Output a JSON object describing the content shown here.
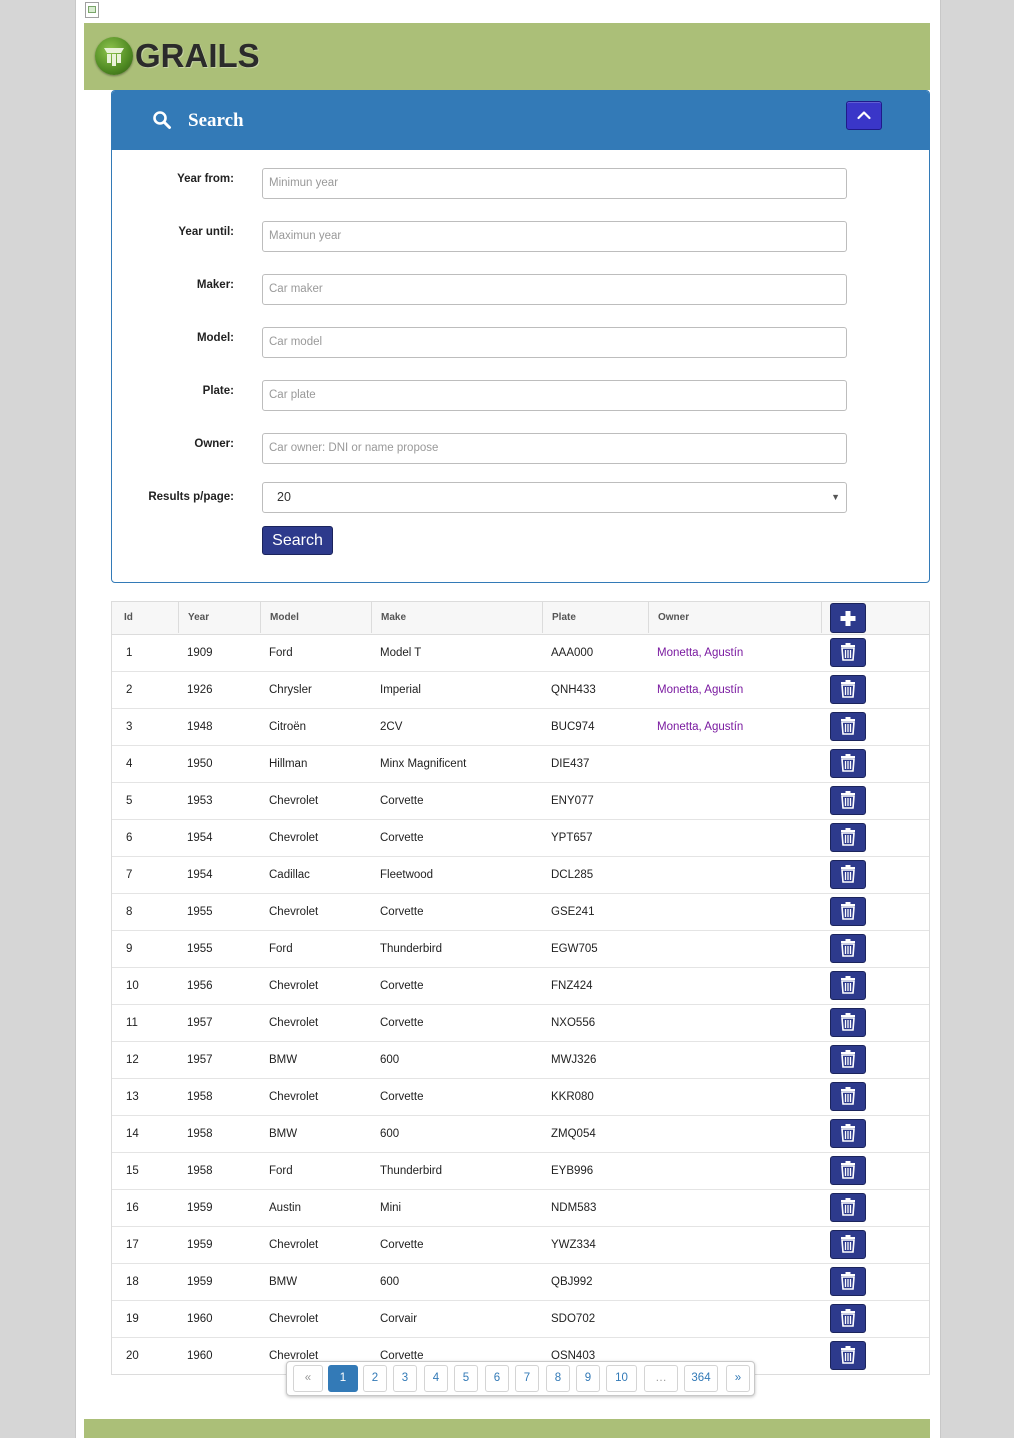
{
  "brand": {
    "name": "GRAILS"
  },
  "search_panel": {
    "title": "Search",
    "fields": [
      {
        "label": "Year from:",
        "placeholder": "Minimun year"
      },
      {
        "label": "Year until:",
        "placeholder": "Maximun year"
      },
      {
        "label": "Maker:",
        "placeholder": "Car maker"
      },
      {
        "label": "Model:",
        "placeholder": "Car model"
      },
      {
        "label": "Plate:",
        "placeholder": "Car plate"
      },
      {
        "label": "Owner:",
        "placeholder": "Car owner: DNI or name propose"
      }
    ],
    "results_per_page": {
      "label": "Results p/page:",
      "value": "20"
    },
    "search_button": "Search"
  },
  "table": {
    "columns": [
      "Id",
      "Year",
      "Model",
      "Make",
      "Plate",
      "Owner"
    ],
    "rows": [
      {
        "id": "1",
        "year": "1909",
        "model": "Ford",
        "make": "Model T",
        "plate": "AAA000",
        "owner": "Monetta, Agustín"
      },
      {
        "id": "2",
        "year": "1926",
        "model": "Chrysler",
        "make": "Imperial",
        "plate": "QNH433",
        "owner": "Monetta, Agustín"
      },
      {
        "id": "3",
        "year": "1948",
        "model": "Citroën",
        "make": "2CV",
        "plate": "BUC974",
        "owner": "Monetta, Agustín"
      },
      {
        "id": "4",
        "year": "1950",
        "model": "Hillman",
        "make": "Minx Magnificent",
        "plate": "DIE437",
        "owner": ""
      },
      {
        "id": "5",
        "year": "1953",
        "model": "Chevrolet",
        "make": "Corvette",
        "plate": "ENY077",
        "owner": ""
      },
      {
        "id": "6",
        "year": "1954",
        "model": "Chevrolet",
        "make": "Corvette",
        "plate": "YPT657",
        "owner": ""
      },
      {
        "id": "7",
        "year": "1954",
        "model": "Cadillac",
        "make": "Fleetwood",
        "plate": "DCL285",
        "owner": ""
      },
      {
        "id": "8",
        "year": "1955",
        "model": "Chevrolet",
        "make": "Corvette",
        "plate": "GSE241",
        "owner": ""
      },
      {
        "id": "9",
        "year": "1955",
        "model": "Ford",
        "make": "Thunderbird",
        "plate": "EGW705",
        "owner": ""
      },
      {
        "id": "10",
        "year": "1956",
        "model": "Chevrolet",
        "make": "Corvette",
        "plate": "FNZ424",
        "owner": ""
      },
      {
        "id": "11",
        "year": "1957",
        "model": "Chevrolet",
        "make": "Corvette",
        "plate": "NXO556",
        "owner": ""
      },
      {
        "id": "12",
        "year": "1957",
        "model": "BMW",
        "make": "600",
        "plate": "MWJ326",
        "owner": ""
      },
      {
        "id": "13",
        "year": "1958",
        "model": "Chevrolet",
        "make": "Corvette",
        "plate": "KKR080",
        "owner": ""
      },
      {
        "id": "14",
        "year": "1958",
        "model": "BMW",
        "make": "600",
        "plate": "ZMQ054",
        "owner": ""
      },
      {
        "id": "15",
        "year": "1958",
        "model": "Ford",
        "make": "Thunderbird",
        "plate": "EYB996",
        "owner": ""
      },
      {
        "id": "16",
        "year": "1959",
        "model": "Austin",
        "make": "Mini",
        "plate": "NDM583",
        "owner": ""
      },
      {
        "id": "17",
        "year": "1959",
        "model": "Chevrolet",
        "make": "Corvette",
        "plate": "YWZ334",
        "owner": ""
      },
      {
        "id": "18",
        "year": "1959",
        "model": "BMW",
        "make": "600",
        "plate": "QBJ992",
        "owner": ""
      },
      {
        "id": "19",
        "year": "1960",
        "model": "Chevrolet",
        "make": "Corvair",
        "plate": "SDO702",
        "owner": ""
      },
      {
        "id": "20",
        "year": "1960",
        "model": "Chevrolet",
        "make": "Corvette",
        "plate": "OSN403",
        "owner": ""
      }
    ]
  },
  "pagination": {
    "items": [
      "«",
      "1",
      "2",
      "3",
      "4",
      "5",
      "6",
      "7",
      "8",
      "9",
      "10",
      "…",
      "364",
      "»"
    ],
    "active": "1"
  },
  "icons": {
    "panel": "search-icon",
    "collapse": "chevron-up-icon",
    "add": "plus-icon",
    "row_action": "trash-icon"
  },
  "colors": {
    "header_green": "#abbf78",
    "panel_blue": "#337ab7",
    "button_navy": "#2d3a8c",
    "collapse_button": "#3a36c8",
    "owner_link": "#7a1aa0"
  }
}
